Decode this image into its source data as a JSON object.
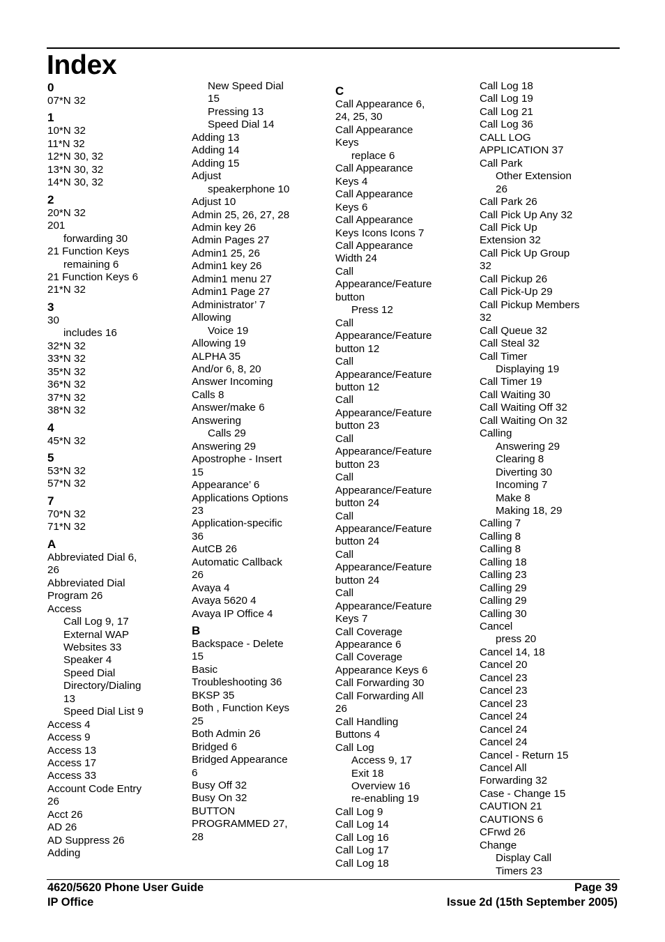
{
  "page": {
    "title": "Index"
  },
  "columns": [
    {
      "lines": [
        {
          "kind": "head",
          "text": "0"
        },
        {
          "kind": "main",
          "text": "07*N 32"
        },
        {
          "kind": "head",
          "text": "1"
        },
        {
          "kind": "main",
          "text": "10*N 32"
        },
        {
          "kind": "main",
          "text": "11*N 32"
        },
        {
          "kind": "main",
          "text": "12*N 30, 32"
        },
        {
          "kind": "main",
          "text": "13*N 30, 32"
        },
        {
          "kind": "main",
          "text": "14*N 30, 32"
        },
        {
          "kind": "head",
          "text": "2"
        },
        {
          "kind": "main",
          "text": "20*N 32"
        },
        {
          "kind": "main",
          "text": "201"
        },
        {
          "kind": "sub",
          "text": "forwarding 30"
        },
        {
          "kind": "main",
          "text": "21 Function Keys"
        },
        {
          "kind": "sub",
          "text": "remaining 6"
        },
        {
          "kind": "main",
          "text": "21 Function Keys 6"
        },
        {
          "kind": "main",
          "text": "21*N 32"
        },
        {
          "kind": "head",
          "text": "3"
        },
        {
          "kind": "main",
          "text": "30"
        },
        {
          "kind": "sub",
          "text": "includes 16"
        },
        {
          "kind": "main",
          "text": "32*N 32"
        },
        {
          "kind": "main",
          "text": "33*N 32"
        },
        {
          "kind": "main",
          "text": "35*N 32"
        },
        {
          "kind": "main",
          "text": "36*N 32"
        },
        {
          "kind": "main",
          "text": "37*N 32"
        },
        {
          "kind": "main",
          "text": "38*N 32"
        },
        {
          "kind": "head",
          "text": "4"
        },
        {
          "kind": "main",
          "text": "45*N 32"
        },
        {
          "kind": "head",
          "text": "5"
        },
        {
          "kind": "main",
          "text": "53*N 32"
        },
        {
          "kind": "main",
          "text": "57*N 32"
        },
        {
          "kind": "head",
          "text": "7"
        },
        {
          "kind": "main",
          "text": "70*N 32"
        },
        {
          "kind": "main",
          "text": "71*N 32"
        },
        {
          "kind": "head",
          "text": "A"
        },
        {
          "kind": "main",
          "text": "Abbreviated Dial 6,"
        },
        {
          "kind": "main",
          "text": "26"
        },
        {
          "kind": "main",
          "text": "Abbreviated Dial"
        },
        {
          "kind": "main",
          "text": "Program 26"
        },
        {
          "kind": "main",
          "text": "Access"
        },
        {
          "kind": "sub",
          "text": "Call Log 9, 17"
        },
        {
          "kind": "sub",
          "text": "External WAP"
        },
        {
          "kind": "sub",
          "text": "Websites 33"
        },
        {
          "kind": "sub",
          "text": "Speaker 4"
        },
        {
          "kind": "sub",
          "text": "Speed Dial"
        },
        {
          "kind": "sub",
          "text": "Directory/Dialing"
        },
        {
          "kind": "sub",
          "text": "13"
        },
        {
          "kind": "sub",
          "text": "Speed Dial List 9"
        },
        {
          "kind": "main",
          "text": "Access 4"
        },
        {
          "kind": "main",
          "text": "Access 9"
        },
        {
          "kind": "main",
          "text": "Access 13"
        },
        {
          "kind": "main",
          "text": "Access 17"
        },
        {
          "kind": "main",
          "text": "Access 33"
        },
        {
          "kind": "main",
          "text": "Account Code Entry"
        },
        {
          "kind": "main",
          "text": "26"
        },
        {
          "kind": "main",
          "text": "Acct 26"
        },
        {
          "kind": "main",
          "text": "AD 26"
        },
        {
          "kind": "main",
          "text": "AD Suppress 26"
        },
        {
          "kind": "main",
          "text": "Adding"
        }
      ]
    },
    {
      "lines": [
        {
          "kind": "sub",
          "text": "New Speed Dial"
        },
        {
          "kind": "sub",
          "text": "15"
        },
        {
          "kind": "sub",
          "text": "Pressing 13"
        },
        {
          "kind": "sub",
          "text": "Speed Dial 14"
        },
        {
          "kind": "main",
          "text": "Adding 13"
        },
        {
          "kind": "main",
          "text": "Adding 14"
        },
        {
          "kind": "main",
          "text": "Adding 15"
        },
        {
          "kind": "main",
          "text": "Adjust"
        },
        {
          "kind": "sub",
          "text": "speakerphone 10"
        },
        {
          "kind": "main",
          "text": "Adjust 10"
        },
        {
          "kind": "main",
          "text": "Admin 25, 26, 27, 28"
        },
        {
          "kind": "main",
          "text": "Admin key 26"
        },
        {
          "kind": "main",
          "text": "Admin Pages 27"
        },
        {
          "kind": "main",
          "text": "Admin1 25, 26"
        },
        {
          "kind": "main",
          "text": "Admin1 key 26"
        },
        {
          "kind": "main",
          "text": "Admin1 menu 27"
        },
        {
          "kind": "main",
          "text": "Admin1 Page 27"
        },
        {
          "kind": "main",
          "text": "Administrator’ 7"
        },
        {
          "kind": "main",
          "text": "Allowing"
        },
        {
          "kind": "sub",
          "text": "Voice 19"
        },
        {
          "kind": "main",
          "text": "Allowing 19"
        },
        {
          "kind": "main",
          "text": "ALPHA 35"
        },
        {
          "kind": "main",
          "text": "And/or 6, 8, 20"
        },
        {
          "kind": "main",
          "text": "Answer Incoming"
        },
        {
          "kind": "main",
          "text": "Calls 8"
        },
        {
          "kind": "main",
          "text": "Answer/make 6"
        },
        {
          "kind": "main",
          "text": "Answering"
        },
        {
          "kind": "sub",
          "text": "Calls 29"
        },
        {
          "kind": "main",
          "text": "Answering 29"
        },
        {
          "kind": "main",
          "text": "Apostrophe - Insert"
        },
        {
          "kind": "main",
          "text": "15"
        },
        {
          "kind": "main",
          "text": "Appearance’ 6"
        },
        {
          "kind": "main",
          "text": "Applications Options"
        },
        {
          "kind": "main",
          "text": "23"
        },
        {
          "kind": "main",
          "text": "Application-specific"
        },
        {
          "kind": "main",
          "text": "36"
        },
        {
          "kind": "main",
          "text": "AutCB 26"
        },
        {
          "kind": "main",
          "text": "Automatic Callback"
        },
        {
          "kind": "main",
          "text": "26"
        },
        {
          "kind": "main",
          "text": "Avaya 4"
        },
        {
          "kind": "main",
          "text": "Avaya 5620 4"
        },
        {
          "kind": "main",
          "text": "Avaya IP Office 4"
        },
        {
          "kind": "head",
          "text": "B"
        },
        {
          "kind": "main",
          "text": "Backspace - Delete"
        },
        {
          "kind": "main",
          "text": "15"
        },
        {
          "kind": "main",
          "text": "Basic"
        },
        {
          "kind": "main",
          "text": "Troubleshooting 36"
        },
        {
          "kind": "main",
          "text": "BKSP 35"
        },
        {
          "kind": "main",
          "text": "Both , Function Keys"
        },
        {
          "kind": "main",
          "text": "25"
        },
        {
          "kind": "main",
          "text": "Both Admin 26"
        },
        {
          "kind": "main",
          "text": "Bridged 6"
        },
        {
          "kind": "main",
          "text": "Bridged Appearance"
        },
        {
          "kind": "main",
          "text": "6"
        },
        {
          "kind": "main",
          "text": "Busy Off 32"
        },
        {
          "kind": "main",
          "text": "Busy On 32"
        },
        {
          "kind": "main",
          "text": "BUTTON"
        },
        {
          "kind": "main",
          "text": "PROGRAMMED 27,"
        },
        {
          "kind": "main",
          "text": "28"
        }
      ]
    },
    {
      "lines": [
        {
          "kind": "head",
          "text": "C"
        },
        {
          "kind": "main",
          "text": "Call Appearance 6,"
        },
        {
          "kind": "main",
          "text": "24, 25, 30"
        },
        {
          "kind": "main",
          "text": "Call Appearance"
        },
        {
          "kind": "main",
          "text": "Keys"
        },
        {
          "kind": "sub",
          "text": "replace 6"
        },
        {
          "kind": "main",
          "text": "Call Appearance"
        },
        {
          "kind": "main",
          "text": "Keys 4"
        },
        {
          "kind": "main",
          "text": "Call Appearance"
        },
        {
          "kind": "main",
          "text": "Keys 6"
        },
        {
          "kind": "main",
          "text": "Call Appearance"
        },
        {
          "kind": "main",
          "text": "Keys Icons Icons 7"
        },
        {
          "kind": "main",
          "text": "Call Appearance"
        },
        {
          "kind": "main",
          "text": "Width 24"
        },
        {
          "kind": "main",
          "text": "Call"
        },
        {
          "kind": "main",
          "text": "Appearance/Feature"
        },
        {
          "kind": "main",
          "text": "button"
        },
        {
          "kind": "sub",
          "text": "Press 12"
        },
        {
          "kind": "main",
          "text": "Call"
        },
        {
          "kind": "main",
          "text": "Appearance/Feature"
        },
        {
          "kind": "main",
          "text": "button 12"
        },
        {
          "kind": "main",
          "text": "Call"
        },
        {
          "kind": "main",
          "text": "Appearance/Feature"
        },
        {
          "kind": "main",
          "text": "button 12"
        },
        {
          "kind": "main",
          "text": "Call"
        },
        {
          "kind": "main",
          "text": "Appearance/Feature"
        },
        {
          "kind": "main",
          "text": "button 23"
        },
        {
          "kind": "main",
          "text": "Call"
        },
        {
          "kind": "main",
          "text": "Appearance/Feature"
        },
        {
          "kind": "main",
          "text": "button 23"
        },
        {
          "kind": "main",
          "text": "Call"
        },
        {
          "kind": "main",
          "text": "Appearance/Feature"
        },
        {
          "kind": "main",
          "text": "button 24"
        },
        {
          "kind": "main",
          "text": "Call"
        },
        {
          "kind": "main",
          "text": "Appearance/Feature"
        },
        {
          "kind": "main",
          "text": "button 24"
        },
        {
          "kind": "main",
          "text": "Call"
        },
        {
          "kind": "main",
          "text": "Appearance/Feature"
        },
        {
          "kind": "main",
          "text": "button 24"
        },
        {
          "kind": "main",
          "text": "Call"
        },
        {
          "kind": "main",
          "text": "Appearance/Feature"
        },
        {
          "kind": "main",
          "text": "Keys 7"
        },
        {
          "kind": "main",
          "text": "Call Coverage"
        },
        {
          "kind": "main",
          "text": "Appearance 6"
        },
        {
          "kind": "main",
          "text": "Call Coverage"
        },
        {
          "kind": "main",
          "text": "Appearance Keys 6"
        },
        {
          "kind": "main",
          "text": "Call Forwarding 30"
        },
        {
          "kind": "main",
          "text": "Call Forwarding All"
        },
        {
          "kind": "main",
          "text": "26"
        },
        {
          "kind": "main",
          "text": "Call Handling"
        },
        {
          "kind": "main",
          "text": "Buttons 4"
        },
        {
          "kind": "main",
          "text": "Call Log"
        },
        {
          "kind": "sub",
          "text": "Access 9, 17"
        },
        {
          "kind": "sub",
          "text": "Exit 18"
        },
        {
          "kind": "sub",
          "text": "Overview 16"
        },
        {
          "kind": "sub",
          "text": "re-enabling 19"
        },
        {
          "kind": "main",
          "text": "Call Log 9"
        },
        {
          "kind": "main",
          "text": "Call Log 14"
        },
        {
          "kind": "main",
          "text": "Call Log 16"
        },
        {
          "kind": "main",
          "text": "Call Log 17"
        },
        {
          "kind": "main",
          "text": "Call Log 18"
        }
      ]
    },
    {
      "lines": [
        {
          "kind": "main",
          "text": "Call Log 18"
        },
        {
          "kind": "main",
          "text": "Call Log 19"
        },
        {
          "kind": "main",
          "text": "Call Log 21"
        },
        {
          "kind": "main",
          "text": "Call Log 36"
        },
        {
          "kind": "main",
          "text": "CALL LOG"
        },
        {
          "kind": "main",
          "text": "APPLICATION 37"
        },
        {
          "kind": "main",
          "text": "Call Park"
        },
        {
          "kind": "sub",
          "text": "Other Extension"
        },
        {
          "kind": "sub",
          "text": "26"
        },
        {
          "kind": "main",
          "text": "Call Park 26"
        },
        {
          "kind": "main",
          "text": "Call Pick Up Any 32"
        },
        {
          "kind": "main",
          "text": "Call Pick Up"
        },
        {
          "kind": "main",
          "text": "Extension 32"
        },
        {
          "kind": "main",
          "text": "Call Pick Up Group"
        },
        {
          "kind": "main",
          "text": "32"
        },
        {
          "kind": "main",
          "text": "Call Pickup 26"
        },
        {
          "kind": "main",
          "text": "Call Pick-Up 29"
        },
        {
          "kind": "main",
          "text": "Call Pickup Members"
        },
        {
          "kind": "main",
          "text": "32"
        },
        {
          "kind": "main",
          "text": "Call Queue 32"
        },
        {
          "kind": "main",
          "text": "Call Steal 32"
        },
        {
          "kind": "main",
          "text": "Call Timer"
        },
        {
          "kind": "sub",
          "text": "Displaying 19"
        },
        {
          "kind": "main",
          "text": "Call Timer 19"
        },
        {
          "kind": "main",
          "text": "Call Waiting 30"
        },
        {
          "kind": "main",
          "text": "Call Waiting Off 32"
        },
        {
          "kind": "main",
          "text": "Call Waiting On 32"
        },
        {
          "kind": "main",
          "text": "Calling"
        },
        {
          "kind": "sub",
          "text": "Answering 29"
        },
        {
          "kind": "sub",
          "text": "Clearing 8"
        },
        {
          "kind": "sub",
          "text": "Diverting 30"
        },
        {
          "kind": "sub",
          "text": "Incoming 7"
        },
        {
          "kind": "sub",
          "text": "Make 8"
        },
        {
          "kind": "sub",
          "text": "Making 18, 29"
        },
        {
          "kind": "main",
          "text": "Calling 7"
        },
        {
          "kind": "main",
          "text": "Calling 8"
        },
        {
          "kind": "main",
          "text": "Calling 8"
        },
        {
          "kind": "main",
          "text": "Calling 18"
        },
        {
          "kind": "main",
          "text": "Calling 23"
        },
        {
          "kind": "main",
          "text": "Calling 29"
        },
        {
          "kind": "main",
          "text": "Calling 29"
        },
        {
          "kind": "main",
          "text": "Calling 30"
        },
        {
          "kind": "main",
          "text": "Cancel"
        },
        {
          "kind": "sub",
          "text": "press 20"
        },
        {
          "kind": "main",
          "text": "Cancel 14, 18"
        },
        {
          "kind": "main",
          "text": "Cancel 20"
        },
        {
          "kind": "main",
          "text": "Cancel 23"
        },
        {
          "kind": "main",
          "text": "Cancel 23"
        },
        {
          "kind": "main",
          "text": "Cancel 23"
        },
        {
          "kind": "main",
          "text": "Cancel 24"
        },
        {
          "kind": "main",
          "text": "Cancel 24"
        },
        {
          "kind": "main",
          "text": "Cancel 24"
        },
        {
          "kind": "main",
          "text": "Cancel - Return 15"
        },
        {
          "kind": "main",
          "text": "Cancel All"
        },
        {
          "kind": "main",
          "text": "Forwarding 32"
        },
        {
          "kind": "main",
          "text": "Case - Change 15"
        },
        {
          "kind": "main",
          "text": "CAUTION 21"
        },
        {
          "kind": "main",
          "text": "CAUTIONS 6"
        },
        {
          "kind": "main",
          "text": "CFrwd 26"
        },
        {
          "kind": "main",
          "text": "Change"
        },
        {
          "kind": "sub",
          "text": "Display Call"
        },
        {
          "kind": "sub",
          "text": "Timers 23"
        }
      ]
    }
  ],
  "footer": {
    "guide_title": "4620/5620 Phone User Guide",
    "product": "IP Office",
    "page_label": "Page 39",
    "issue": "Issue 2d (15th September 2005)"
  }
}
